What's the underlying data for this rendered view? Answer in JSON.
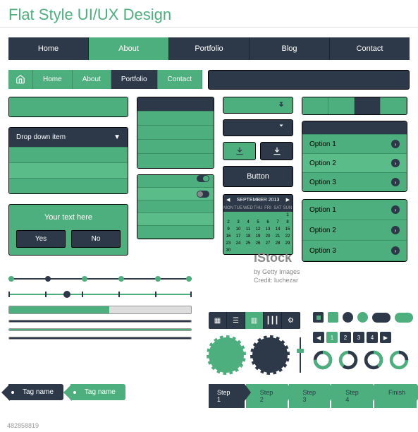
{
  "title": "Flat Style UI/UX Design",
  "nav1": [
    "Home",
    "About",
    "Portfolio",
    "Blog",
    "Contact"
  ],
  "nav1_active": 1,
  "nav2": [
    "Home",
    "About",
    "Portfolio",
    "Contact"
  ],
  "nav2_active": 2,
  "dropdown": {
    "label": "Drop down item"
  },
  "dialog": {
    "msg": "Your text here",
    "yes": "Yes",
    "no": "No"
  },
  "button_label": "Button",
  "options": [
    "Option 1",
    "Option 2",
    "Option 3"
  ],
  "options2": [
    "Option 1",
    "Option 2",
    "Option 3"
  ],
  "calendar": {
    "title": "SEPTEMBER  2013",
    "days": [
      "MON",
      "TUE",
      "WED",
      "THU",
      "FRI",
      "SAT",
      "SUN"
    ],
    "cells": [
      "",
      "",
      "",
      "",
      "",
      "",
      "1",
      "2",
      "3",
      "4",
      "5",
      "6",
      "7",
      "8",
      "9",
      "10",
      "11",
      "12",
      "13",
      "14",
      "15",
      "16",
      "17",
      "18",
      "19",
      "20",
      "21",
      "22",
      "23",
      "24",
      "25",
      "26",
      "27",
      "28",
      "29",
      "30",
      "",
      "",
      "",
      "",
      "",
      ""
    ]
  },
  "watermark": {
    "brand": "iStock",
    "credit": "by Getty Images",
    "artist": "Credit: luchezar"
  },
  "pagination": [
    "1",
    "2",
    "3",
    "4"
  ],
  "steps": [
    "Step 1",
    "Step 2",
    "Step 3",
    "Step 4",
    "Finish"
  ],
  "steps_done": 0,
  "tags": [
    "Tag name",
    "Tag name"
  ],
  "donuts": [
    75,
    60,
    40,
    25
  ],
  "colors": {
    "green": "#4caf7d",
    "dark": "#2d3849"
  },
  "footer": {
    "id": "482858819",
    "sig": ""
  }
}
